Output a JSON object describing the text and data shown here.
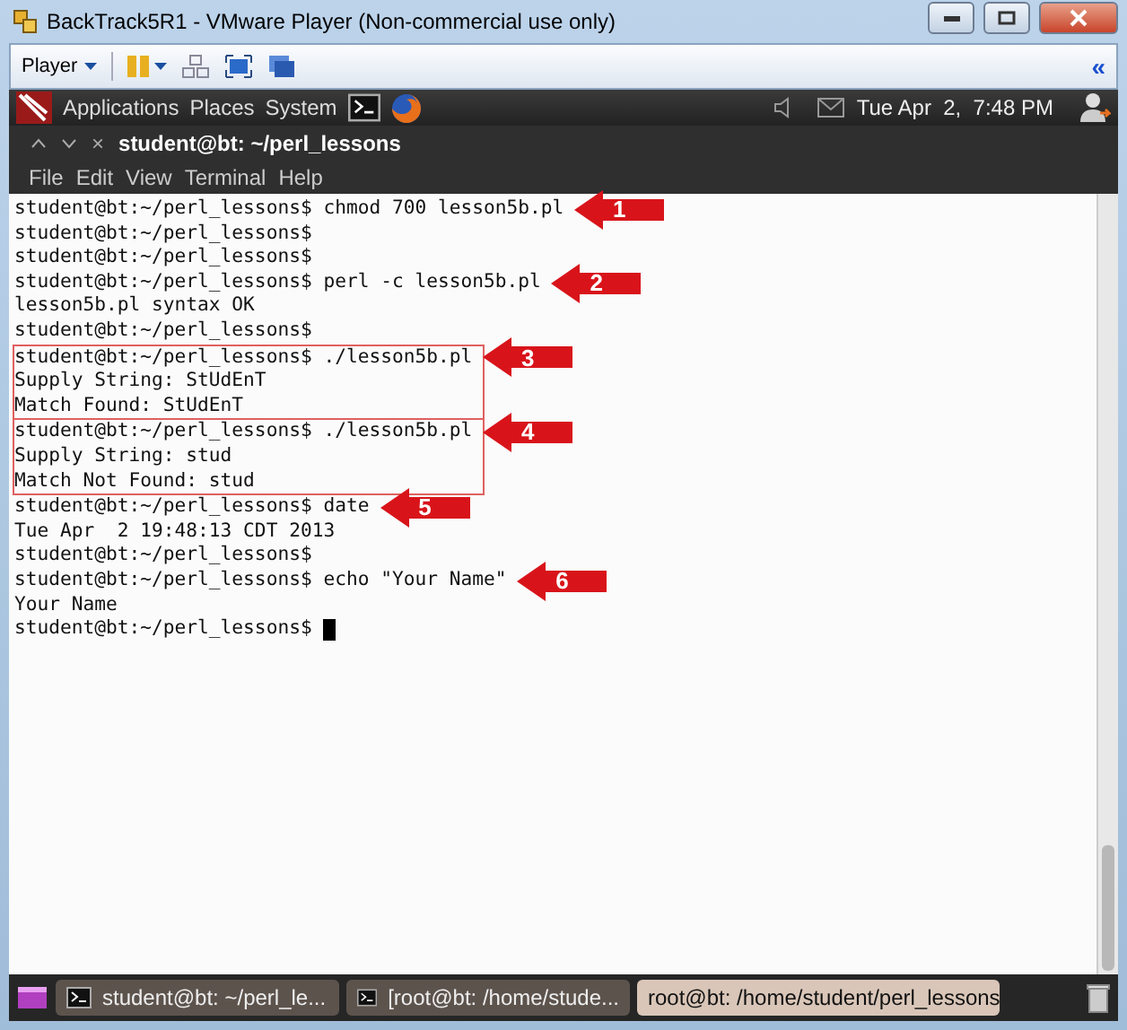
{
  "window": {
    "title": "BackTrack5R1 - VMware Player (Non-commercial use only)"
  },
  "toolbar": {
    "player_menu": "Player",
    "collapse": "«"
  },
  "panel": {
    "menus": [
      "Applications",
      "Places",
      "System"
    ],
    "clock": "Tue Apr  2,  7:48 PM"
  },
  "terminal": {
    "tab_title": "student@bt: ~/perl_lessons",
    "close": "×",
    "menu": [
      "File",
      "Edit",
      "View",
      "Terminal",
      "Help"
    ],
    "groups": [
      {
        "framed": false,
        "lines": [
          {
            "text": "student@bt:~/perl_lessons$ chmod 700 lesson5b.pl",
            "marker": "1"
          },
          {
            "text": "student@bt:~/perl_lessons$"
          },
          {
            "text": "student@bt:~/perl_lessons$"
          },
          {
            "text": "student@bt:~/perl_lessons$ perl -c lesson5b.pl",
            "marker": "2"
          },
          {
            "text": "lesson5b.pl syntax OK"
          },
          {
            "text": "student@bt:~/perl_lessons$"
          }
        ]
      },
      {
        "framed": true,
        "lines": [
          {
            "text": "student@bt:~/perl_lessons$ ./lesson5b.pl",
            "marker": "3"
          },
          {
            "text": "Supply String: StUdEnT"
          },
          {
            "text": "Match Found: StUdEnT"
          }
        ]
      },
      {
        "framed": true,
        "lines": [
          {
            "text": "student@bt:~/perl_lessons$ ./lesson5b.pl",
            "marker": "4"
          },
          {
            "text": "Supply String: stud"
          },
          {
            "text": "Match Not Found: stud"
          }
        ]
      },
      {
        "framed": false,
        "lines": [
          {
            "text": "student@bt:~/perl_lessons$ date",
            "marker": "5"
          },
          {
            "text": "Tue Apr  2 19:48:13 CDT 2013"
          },
          {
            "text": "student@bt:~/perl_lessons$"
          },
          {
            "text": "student@bt:~/perl_lessons$ echo \"Your Name\"",
            "marker": "6"
          },
          {
            "text": "Your Name"
          },
          {
            "text": "student@bt:~/perl_lessons$",
            "cursor": true
          }
        ]
      }
    ]
  },
  "taskbar": {
    "tasks": [
      {
        "label": "student@bt: ~/perl_le...",
        "icon": true,
        "selected": false
      },
      {
        "label": "[root@bt: /home/stude...",
        "icon": true,
        "selected": false
      },
      {
        "label": "root@bt: /home/student/perl_lessons",
        "icon": false,
        "selected": true
      }
    ]
  }
}
